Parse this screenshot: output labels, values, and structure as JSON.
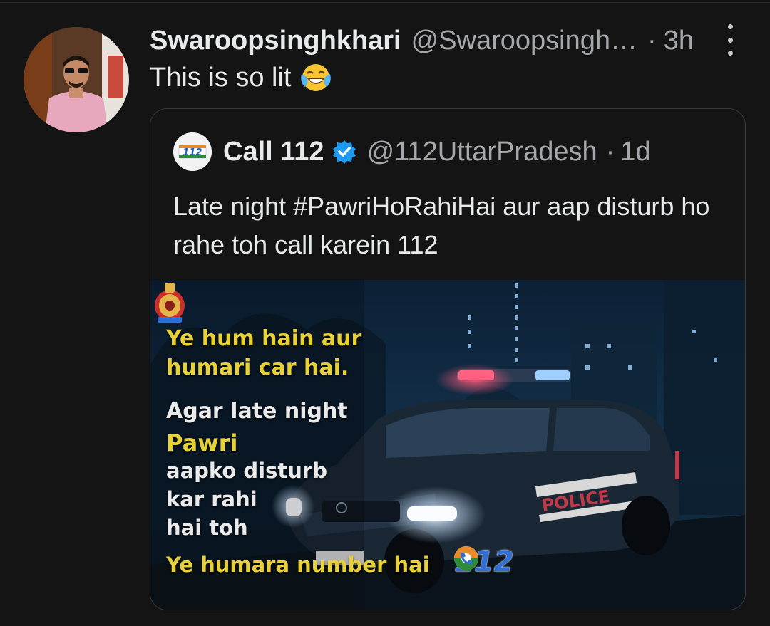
{
  "tweet": {
    "author_name": "Swaroopsinghkhari",
    "author_handle": "@Swaroopsingh…",
    "separator": "·",
    "time": "3h",
    "text": "This is so lit",
    "emoji": "face-with-tears-of-joy-icon"
  },
  "quoted_tweet": {
    "author_name": "Call 112",
    "author_handle": "@112UttarPradesh",
    "separator": "·",
    "time": "1d",
    "verified": true,
    "text": "Late night #PawriHoRahiHai aur aap disturb ho rahe toh call karein 112",
    "media": {
      "line1": "Ye hum hain aur",
      "line2": "humari car hai.",
      "line3": "Agar late night",
      "line4": "Pawri",
      "line5": "aapko disturb",
      "line6": "kar rahi",
      "line7": "hai toh",
      "line8": "Ye humara number hai",
      "logo_number": "112",
      "car_label": "POLICE"
    }
  },
  "logo_badge_text": "112",
  "colors": {
    "background": "#141414",
    "text": "#e7e9ea",
    "muted": "#a6a8ab",
    "verified": "#1d9bf0",
    "overlay_yellow": "#e8d039"
  }
}
